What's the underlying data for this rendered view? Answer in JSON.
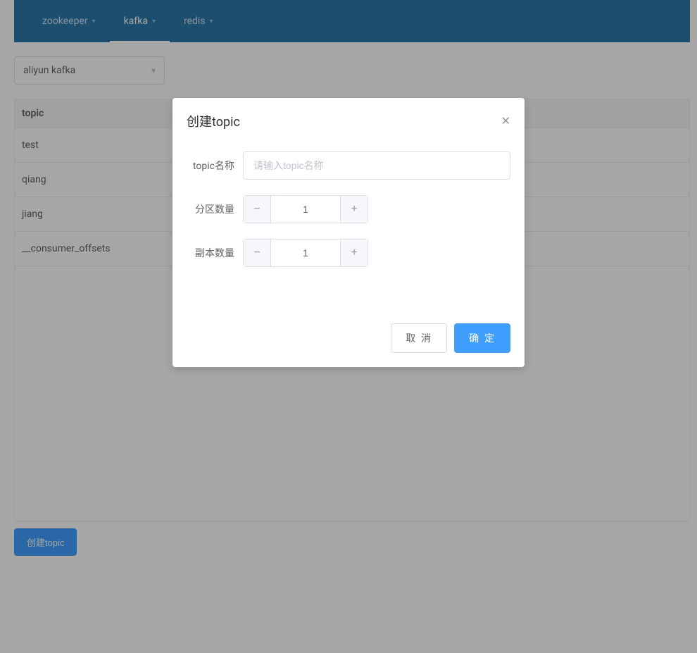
{
  "nav": {
    "items": [
      {
        "label": "zookeeper",
        "active": false
      },
      {
        "label": "kafka",
        "active": true
      },
      {
        "label": "redis",
        "active": false
      }
    ]
  },
  "select": {
    "value": "aliyun kafka"
  },
  "table": {
    "header": "topic",
    "rows": [
      "test",
      "qiang",
      "jiang",
      "__consumer_offsets"
    ]
  },
  "create_button": "创建topic",
  "dialog": {
    "title": "创建topic",
    "fields": {
      "name_label": "topic名称",
      "name_placeholder": "请输入topic名称",
      "partitions_label": "分区数量",
      "partitions_value": "1",
      "replicas_label": "副本数量",
      "replicas_value": "1"
    },
    "cancel": "取 消",
    "confirm": "确 定"
  }
}
